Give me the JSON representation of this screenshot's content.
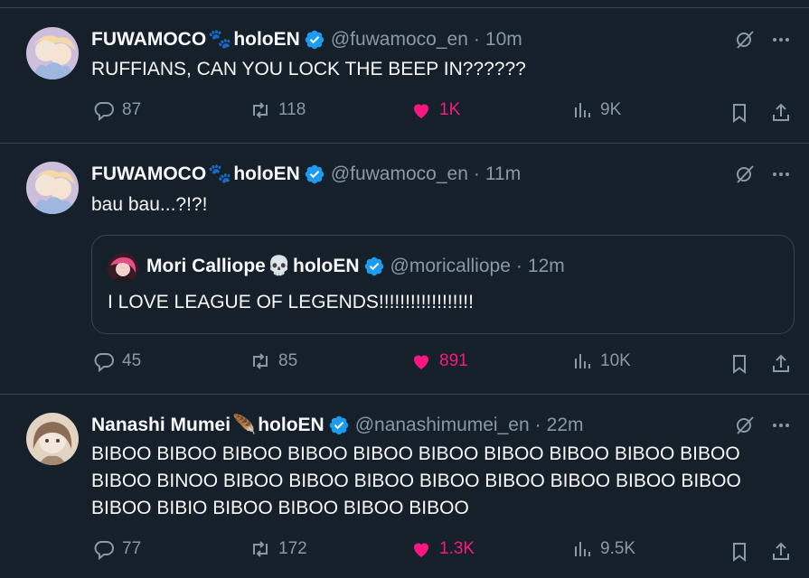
{
  "tweets": [
    {
      "display_name": "FUWAMOCO",
      "name_emoji": "🐾",
      "name_suffix": "holoEN",
      "handle": "@fuwamoco_en",
      "time": "10m",
      "text": "RUFFIANS, CAN YOU LOCK THE BEEP IN??????",
      "replies": "87",
      "retweets": "118",
      "likes": "1K",
      "views": "9K",
      "avatar_color": "#c9b7d8",
      "liked": true
    },
    {
      "display_name": "FUWAMOCO",
      "name_emoji": "🐾",
      "name_suffix": "holoEN",
      "handle": "@fuwamoco_en",
      "time": "11m",
      "text": "bau bau...?!?!",
      "replies": "45",
      "retweets": "85",
      "likes": "891",
      "views": "10K",
      "avatar_color": "#c9b7d8",
      "liked": true,
      "quote": {
        "display_name": "Mori Calliope",
        "name_emoji": "💀",
        "name_suffix": "holoEN",
        "handle": "@moricalliope",
        "time": "12m",
        "text": "I LOVE LEAGUE OF LEGENDS!!!!!!!!!!!!!!!!!!",
        "avatar_color": "#8e2a3a"
      }
    },
    {
      "display_name": "Nanashi Mumei",
      "name_emoji": "🪶",
      "name_suffix": "holoEN",
      "handle": "@nanashimumei_en",
      "time": "22m",
      "text_lines": [
        "BIBOO BIBOO BIBOO BIBOO BIBOO BIBOO BIBOO BIBOO BIBOO BIBOO",
        "BIBOO BINOO BIBOO BIBOO BIBOO BIBOO BIBOO BIBOO BIBOO BIBOO",
        "BIBOO BIBIO BIBOO BIBOO BIBOO BIBOO"
      ],
      "replies": "77",
      "retweets": "172",
      "likes": "1.3K",
      "views": "9.5K",
      "avatar_color": "#d9c6b2",
      "liked": true
    }
  ],
  "colors": {
    "background": "#15202b",
    "border": "#38444d",
    "muted": "#8b98a5",
    "like": "#f91880",
    "verified": "#1d9bf0"
  },
  "dot": "·"
}
